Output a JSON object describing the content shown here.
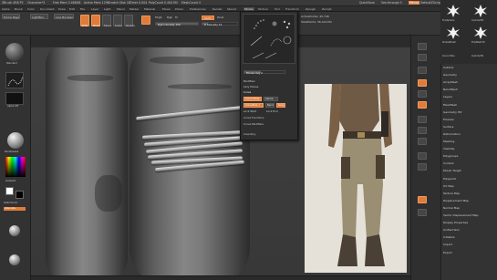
{
  "titlebar": {
    "app": "ZBrush 4R8 P2",
    "doc": "Character*2",
    "mem": "Free Mem 3.468GB",
    "active": "Active Mem 1297",
    "scratch": "Scratch Disk 44",
    "timer": "Timer 0.004",
    "poly": "PolyCount 0.404 Mil",
    "mesh": "MeshCount 4",
    "quicksave": "QuickSave",
    "seethrough": "See-through 0",
    "menus": "Menus",
    "defaultscript": "DefaultZScript"
  },
  "menubar": [
    "Alpha",
    "Brush",
    "Color",
    "Document",
    "Draw",
    "Edit",
    "File",
    "Layer",
    "Light",
    "Macro",
    "Marker",
    "Material",
    "Movie",
    "Picker",
    "Preferences",
    "Render",
    "Stencil",
    "Stroke",
    "Texture",
    "Tool",
    "Transform",
    "Zplugin",
    "Zscript"
  ],
  "menubar_active": "Stroke",
  "shelf": {
    "homepage": "Home Page",
    "lightbox": "LightBox",
    "livebool": "Live Boolean",
    "edit": "Edit",
    "draw": "Draw",
    "move": "Move",
    "scale": "Scale",
    "rotate": "Rotate",
    "mrgb": "Mrgb",
    "rgb": "Rgb",
    "m": "M",
    "rgb_int": "Rgb Intensity 100",
    "zadd": "Zadd",
    "zsub": "Zsub",
    "z_int": "Z Intensity 15",
    "focal": "Focal Shift 0",
    "drawsize": "Draw Size 15",
    "dynamic": "Dynamic",
    "active_points": "ActivePoints: 45,746",
    "total_points": "TotalPoints: 36.410 Mil"
  },
  "popup": {
    "mouse_avg": "Mouse Avg 4",
    "modifiers": "Modifiers",
    "lazymouse": "Lazy Mouse",
    "curve": "Curve",
    "curve_mode": "Curve Mode",
    "as_line": "AsLine",
    "curve_step": "CurveStep 1",
    "bend": "Bend",
    "snap": "Snap",
    "lock_start": "Lock Start",
    "lock_end": "Lock End",
    "curve_functions": "Curve Functions",
    "curve_modifiers": "Curve Modifiers",
    "inventory": "Inventory"
  },
  "left": {
    "stdbrush": "Standard",
    "alpha_off": "Alpha Off",
    "texture_off": "Texture Off",
    "matcap": "SkinShade4",
    "gradient": "Gradient",
    "switch_color": "SwitchColor",
    "alternate": "Alternate"
  },
  "rightcol": [
    "Subtool",
    "Geometry",
    "ArrayMesh",
    "NanoMesh",
    "Layers",
    "FiberMesh",
    "Geometry HD",
    "Preview",
    "Surface",
    "Deformation",
    "Masking",
    "Visibility",
    "Polygroups",
    "Contact",
    "Morph Target",
    "Polypaint",
    "UV Map",
    "Texture Map",
    "Displacement Map",
    "Normal Map",
    "Vector Displacement Map",
    "Display Properties",
    "Unified Skin",
    "Initialize",
    "Import",
    "Export"
  ],
  "brushes": [
    "PolySphere",
    "Cylinder3D",
    "SimpleBrush",
    "PolyMesh3D",
    "Curve Tube",
    "Cylinder3D"
  ],
  "colors": {
    "accent": "#e07b39",
    "bg": "#2b2b2b",
    "panel": "#333333"
  }
}
